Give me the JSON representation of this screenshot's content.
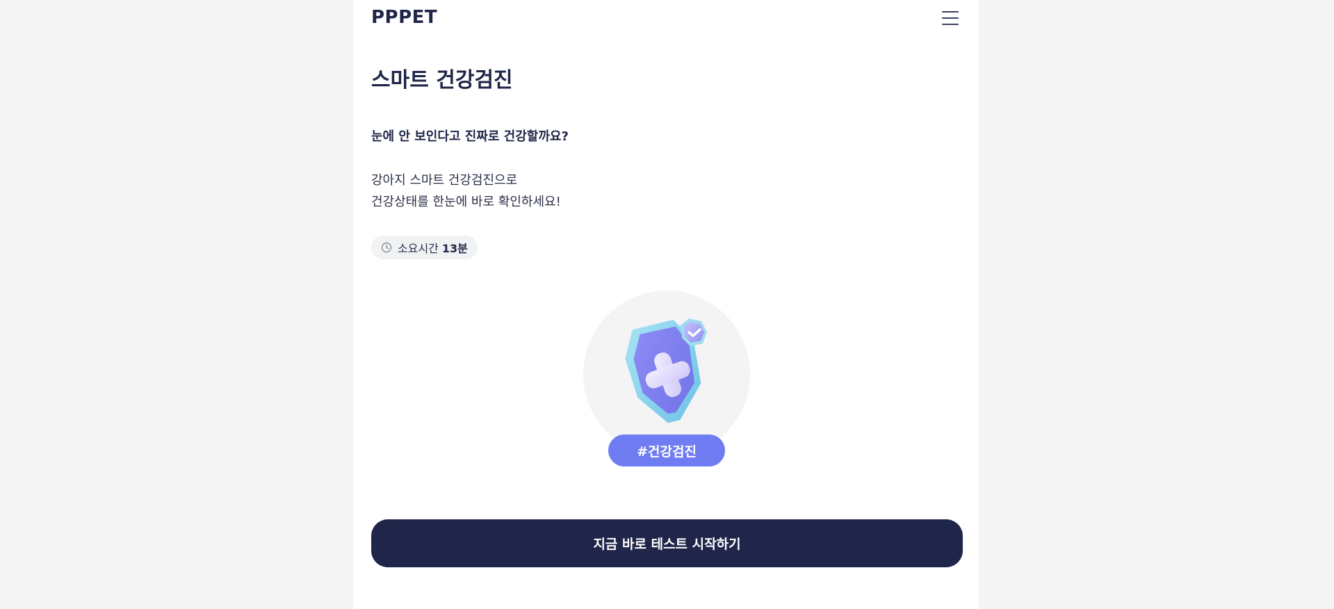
{
  "header": {
    "logo": "PPPET",
    "menu_icon": "hamburger-menu-icon"
  },
  "main": {
    "title": "스마트 건강검진",
    "question": "눈에 안 보인다고 진짜로 건강할까요?",
    "description_lines": [
      "강아지 스마트 건강검진으로",
      "건강상태를 한눈에 바로 확인하세요!"
    ],
    "duration": {
      "icon": "clock-icon",
      "label": "소요시간",
      "value": "13분"
    },
    "illustration": {
      "icon": "health-shield-icon",
      "tag": "#건강검진"
    }
  },
  "cta": {
    "start_label": "지금 바로 테스트 시작하기"
  },
  "colors": {
    "brand_navy": "#20264a",
    "tag_purple": "#6f7cf2",
    "page_bg": "#f5f5f5"
  }
}
